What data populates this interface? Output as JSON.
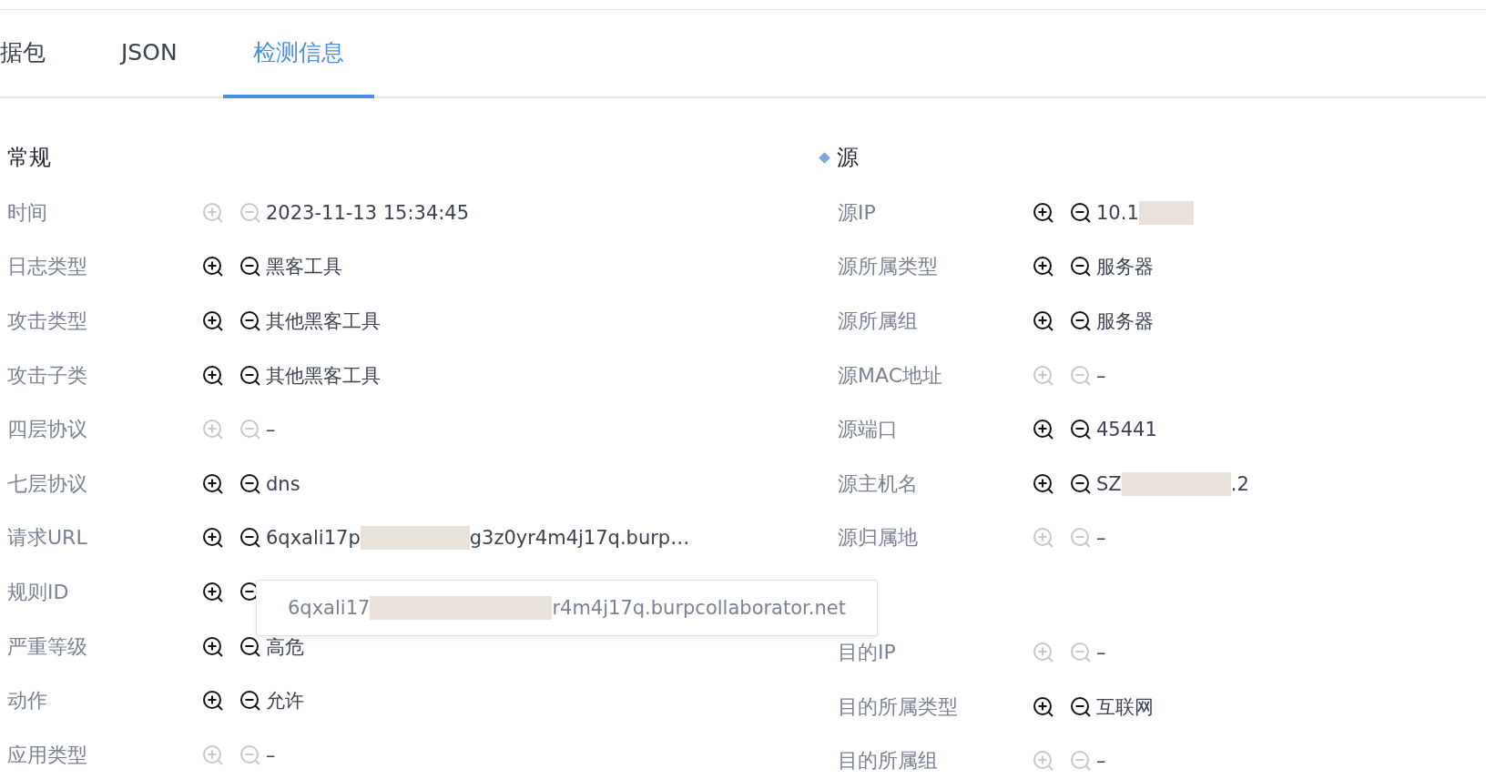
{
  "tabs": [
    {
      "label": "据包",
      "selected": false
    },
    {
      "label": "JSON",
      "selected": false
    },
    {
      "label": "检测信息",
      "selected": true
    }
  ],
  "general": {
    "title": "常规",
    "rows": [
      {
        "label": "时间",
        "filters_enabled": false,
        "value": "2023-11-13 15:34:45"
      },
      {
        "label": "日志类型",
        "filters_enabled": true,
        "value": "黑客工具"
      },
      {
        "label": "攻击类型",
        "filters_enabled": true,
        "value": "其他黑客工具"
      },
      {
        "label": "攻击子类",
        "filters_enabled": true,
        "value": "其他黑客工具"
      },
      {
        "label": "四层协议",
        "filters_enabled": false,
        "value": "–"
      },
      {
        "label": "七层协议",
        "filters_enabled": true,
        "value": "dns"
      },
      {
        "label": "请求URL",
        "filters_enabled": true,
        "value": "6qxali17p",
        "redacted": true,
        "value_end": "g3z0yr4m4j17q.burp…"
      },
      {
        "label": "规则ID",
        "filters_enabled": true,
        "tooltip": {
          "text": "6qxali17",
          "text_end": "r4m4j17q.burpcollaborator.net"
        }
      },
      {
        "label": "严重等级",
        "filters_enabled": true,
        "value": "高危"
      },
      {
        "label": "动作",
        "filters_enabled": true,
        "value": "允许"
      },
      {
        "label": "应用类型",
        "filters_enabled": false,
        "value": "–"
      }
    ]
  },
  "source": {
    "title": "源",
    "bullet": true,
    "rows": [
      {
        "label": "源IP",
        "filters_enabled": true,
        "value": "10.1",
        "redacted": true
      },
      {
        "label": "源所属类型",
        "filters_enabled": true,
        "value": "服务器"
      },
      {
        "label": "源所属组",
        "filters_enabled": true,
        "value": "服务器"
      },
      {
        "label": "源MAC地址",
        "filters_enabled": false,
        "value": "–"
      },
      {
        "label": "源端口",
        "filters_enabled": true,
        "value": "45441"
      },
      {
        "label": "源主机名",
        "filters_enabled": true,
        "value": "SZ",
        "redacted": true,
        "value_end": ".2"
      },
      {
        "label": "源归属地",
        "filters_enabled": false,
        "value": "–"
      }
    ]
  },
  "destination": {
    "rows": [
      {
        "label": "目的IP",
        "filters_enabled": false,
        "value": "–"
      },
      {
        "label": "目的所属类型",
        "filters_enabled": true,
        "value": "互联网"
      },
      {
        "label": "目的所属组",
        "filters_enabled": false,
        "value": "–"
      }
    ]
  }
}
